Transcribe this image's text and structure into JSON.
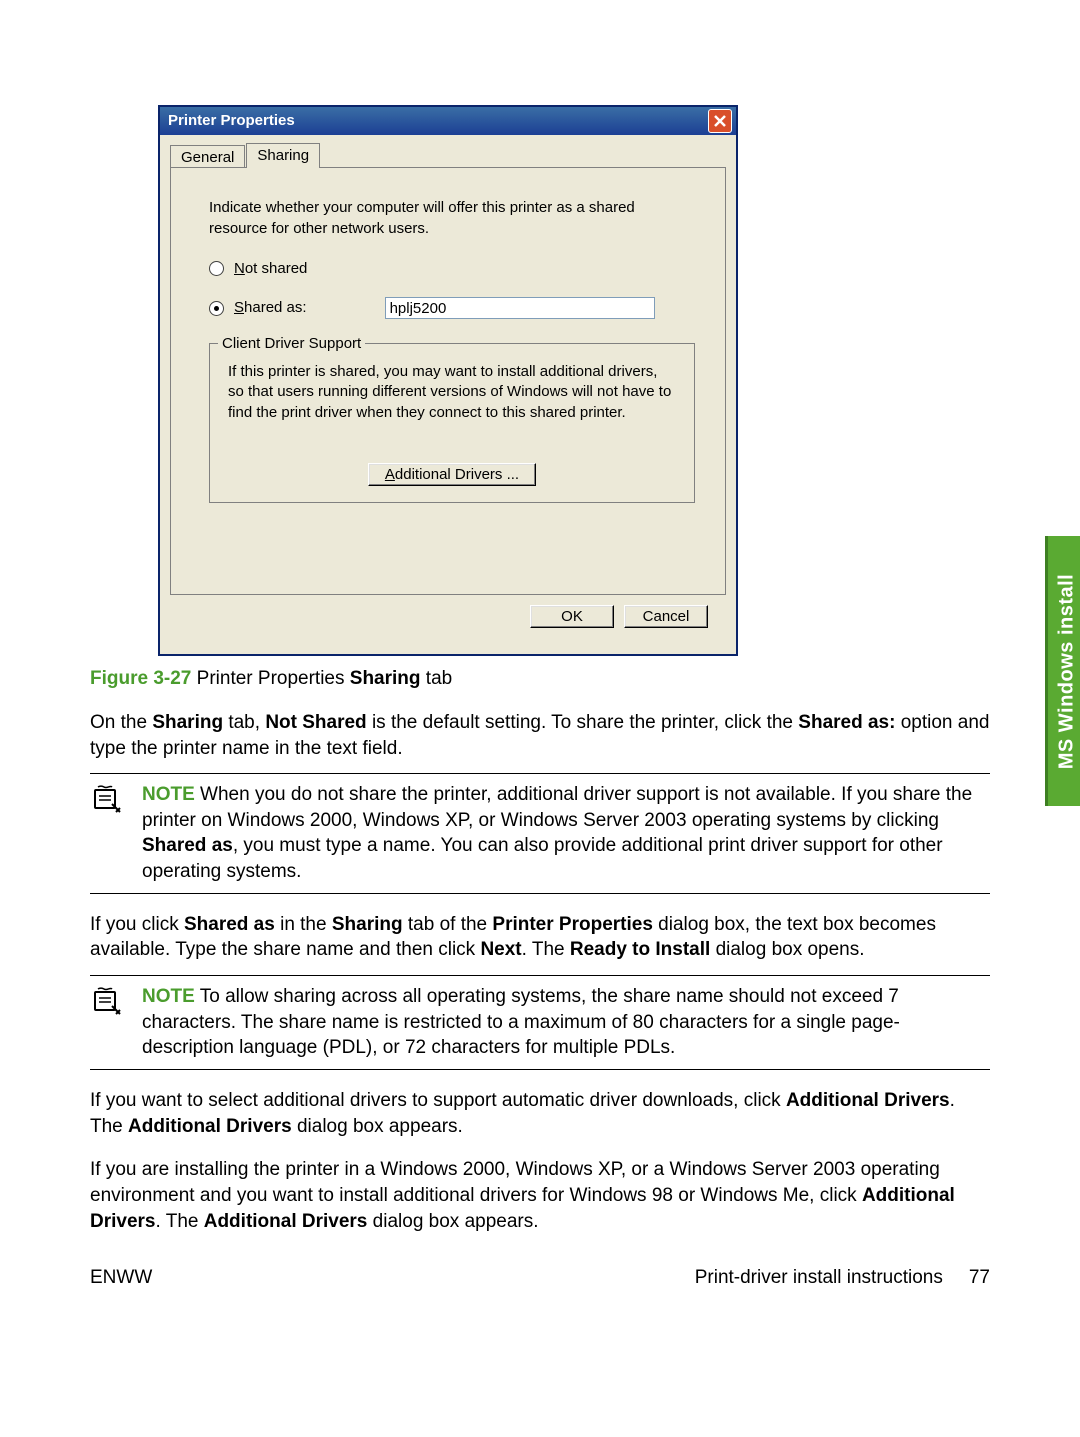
{
  "dialog": {
    "title": "Printer Properties",
    "tabs": {
      "general": "General",
      "sharing": "Sharing"
    },
    "sharing_intro": "Indicate whether your computer will offer this printer as a shared resource for other network users.",
    "radio_not_shared_u": "N",
    "radio_not_shared_rest": "ot shared",
    "radio_shared_u": "S",
    "radio_shared_rest": "hared as:",
    "share_name": "hplj5200",
    "fieldset_title": "Client Driver Support",
    "fieldset_text": "If this printer is shared, you may want to install additional drivers, so that users running different versions of Windows will not have to find the print driver when they connect to this shared printer.",
    "drivers_btn_u": "A",
    "drivers_btn_rest": "dditional Drivers ...",
    "ok": "OK",
    "cancel": "Cancel"
  },
  "figure": {
    "num": "Figure 3-27",
    "text_a": "  Printer Properties ",
    "text_b": "Sharing",
    "text_c": " tab"
  },
  "para1": {
    "a": "On the ",
    "b": "Sharing",
    "c": " tab, ",
    "d": "Not Shared",
    "e": " is the default setting. To share the printer, click the ",
    "f": "Shared as:",
    "g": " option and type the printer name in the text field."
  },
  "note1": {
    "label": "NOTE",
    "a": "   When you do not share the printer, additional driver support is not available. If you share the printer on Windows 2000, Windows XP, or Windows Server 2003 operating systems by clicking ",
    "b": "Shared as",
    "c": ", you must type a name. You can also provide additional print driver support for other operating systems."
  },
  "para2": {
    "a": "If you click ",
    "b": "Shared as",
    "c": " in the ",
    "d": "Sharing",
    "e": " tab of the ",
    "f": "Printer Properties",
    "g": " dialog box, the text box becomes available. Type the share name and then click ",
    "h": "Next",
    "i": ". The ",
    "j": "Ready to Install",
    "k": " dialog box opens."
  },
  "note2": {
    "label": "NOTE",
    "text": "   To allow sharing across all operating systems, the share name should not exceed 7 characters. The share name is restricted to a maximum of 80 characters for a single page-description language (PDL), or 72 characters for multiple PDLs."
  },
  "para3": {
    "a": "If you want to select additional drivers to support automatic driver downloads, click ",
    "b": "Additional Drivers",
    "c": ". The ",
    "d": "Additional Drivers",
    "e": " dialog box appears."
  },
  "para4": {
    "a": "If you are installing the printer in a Windows 2000, Windows XP, or a Windows Server 2003 operating environment and you want to install additional drivers for Windows 98 or Windows Me, click ",
    "b": "Additional Drivers",
    "c": ". The ",
    "d": "Additional Drivers",
    "e": " dialog box appears."
  },
  "sidetab": "MS Windows install",
  "footer": {
    "left": "ENWW",
    "right": "Print-driver install instructions",
    "page": "77"
  }
}
